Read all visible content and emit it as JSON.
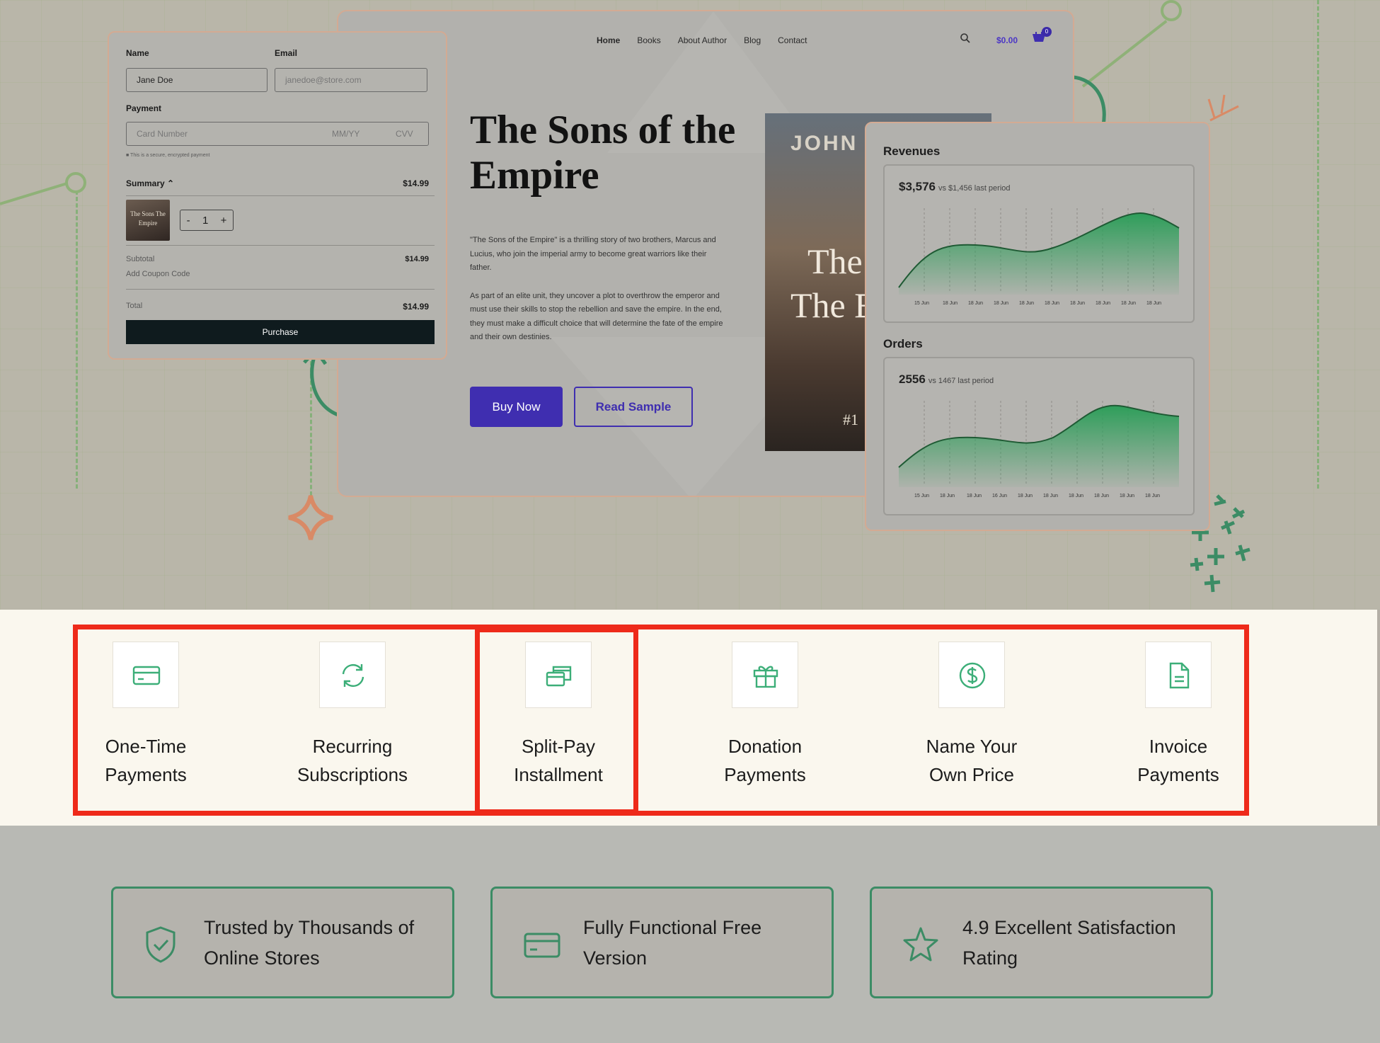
{
  "store": {
    "nav": [
      "Home",
      "Books",
      "About Author",
      "Blog",
      "Contact"
    ],
    "cart_total": "$0.00",
    "cart_count": "0",
    "book_title": "The Sons of the Empire",
    "description": [
      "\"The Sons of the Empire\" is a thrilling story of two brothers, Marcus and Lucius, who join the imperial army to become great warriors like their father.",
      "As part of an elite unit, they uncover a plot to overthrow the emperor and must use their skills to stop the rebellion and save the empire. In the end, they must make a difficult choice that will determine the fate of the empire and their own destinies."
    ],
    "buy_label": "Buy Now",
    "sample_label": "Read Sample",
    "cover": {
      "author": "JOHN",
      "line1": "The",
      "line2": "The E",
      "badge": "#1"
    }
  },
  "checkout": {
    "name_label": "Name",
    "email_label": "Email",
    "name_value": "Jane Doe",
    "email_placeholder": "janedoe@store.com",
    "payment_label": "Payment",
    "card_placeholder": "Card Number",
    "expiry_placeholder": "MM/YY",
    "cvv_placeholder": "CVV",
    "secure_note": "This is a secure, encrypted payment",
    "summary_label": "Summary",
    "summary_price": "$14.99",
    "thumb_title": "The Sons The Empire",
    "quantity": "1",
    "subtotal_label": "Subtotal",
    "subtotal_value": "$14.99",
    "coupon_label": "Add Coupon Code",
    "total_label": "Total",
    "total_value": "$14.99",
    "purchase_label": "Purchase"
  },
  "analytics": {
    "revenues": {
      "title": "Revenues",
      "value": "$3,576",
      "compare": "vs $1,456 last period",
      "ticks": [
        "15 Jun",
        "18 Jun",
        "18 Jun",
        "18 Jun",
        "18 Jun",
        "18 Jun",
        "18 Jun",
        "18 Jun",
        "18 Jun",
        "18 Jun"
      ]
    },
    "orders": {
      "title": "Orders",
      "value": "2556",
      "compare": "vs 1467 last period",
      "ticks": [
        "15 Jun",
        "18 Jun",
        "18 Jun",
        "16 Jun",
        "18 Jun",
        "18 Jun",
        "18 Jun",
        "18 Jun",
        "18 Jun",
        "18 Jun"
      ]
    }
  },
  "features": [
    {
      "icon": "credit-card-icon",
      "line1": "One-Time",
      "line2": "Payments"
    },
    {
      "icon": "refresh-icon",
      "line1": "Recurring",
      "line2": "Subscriptions"
    },
    {
      "icon": "cards-stack-icon",
      "line1": "Split-Pay",
      "line2": "Installment"
    },
    {
      "icon": "gift-icon",
      "line1": "Donation",
      "line2": "Payments"
    },
    {
      "icon": "dollar-coin-icon",
      "line1": "Name Your",
      "line2": "Own Price"
    },
    {
      "icon": "document-icon",
      "line1": "Invoice",
      "line2": "Payments"
    }
  ],
  "trust": [
    {
      "icon": "shield-check-icon",
      "text": "Trusted by Thousands of Online Stores"
    },
    {
      "icon": "credit-card-icon",
      "text": "Fully Functional Free Version"
    },
    {
      "icon": "star-icon",
      "text": "4.9 Excellent Satisfaction Rating"
    }
  ],
  "colors": {
    "accent_green": "#3c8c65",
    "brand_purple": "#3f2eb0",
    "highlight_red": "#ee2a1a",
    "band_bg": "#faf7ee"
  }
}
